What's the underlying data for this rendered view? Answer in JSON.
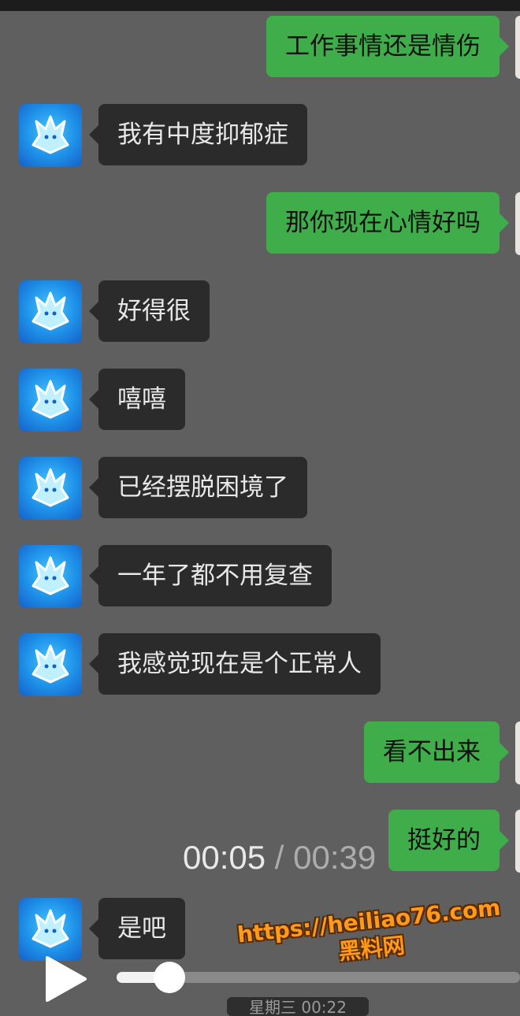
{
  "messages": [
    {
      "side": "out",
      "text": "工作事情还是情伤"
    },
    {
      "side": "in",
      "text": "我有中度抑郁症"
    },
    {
      "side": "out",
      "text": "那你现在心情好吗"
    },
    {
      "side": "in",
      "text": "好得很"
    },
    {
      "side": "in",
      "text": "嘻嘻"
    },
    {
      "side": "in",
      "text": "已经摆脱困境了"
    },
    {
      "side": "in",
      "text": "一年了都不用复查"
    },
    {
      "side": "in",
      "text": "我感觉现在是个正常人"
    },
    {
      "side": "out",
      "text": "看不出来"
    },
    {
      "side": "out",
      "text": "挺好的"
    },
    {
      "side": "in",
      "text": "是吧"
    }
  ],
  "player": {
    "current_time": "00:05",
    "separator": "/",
    "total_time": "00:39",
    "progress": 0.13,
    "play_icon": "play-icon"
  },
  "date_label": "星期三 00:22",
  "watermark": {
    "url": "https://heiliao76.com",
    "site": "黑料网"
  },
  "colors": {
    "background": "#5f5f5f",
    "incoming_bubble": "#2b2b2b",
    "outgoing_bubble": "#3fae4a",
    "avatar": "#1e90e8",
    "watermark": "#ff9a1a"
  }
}
